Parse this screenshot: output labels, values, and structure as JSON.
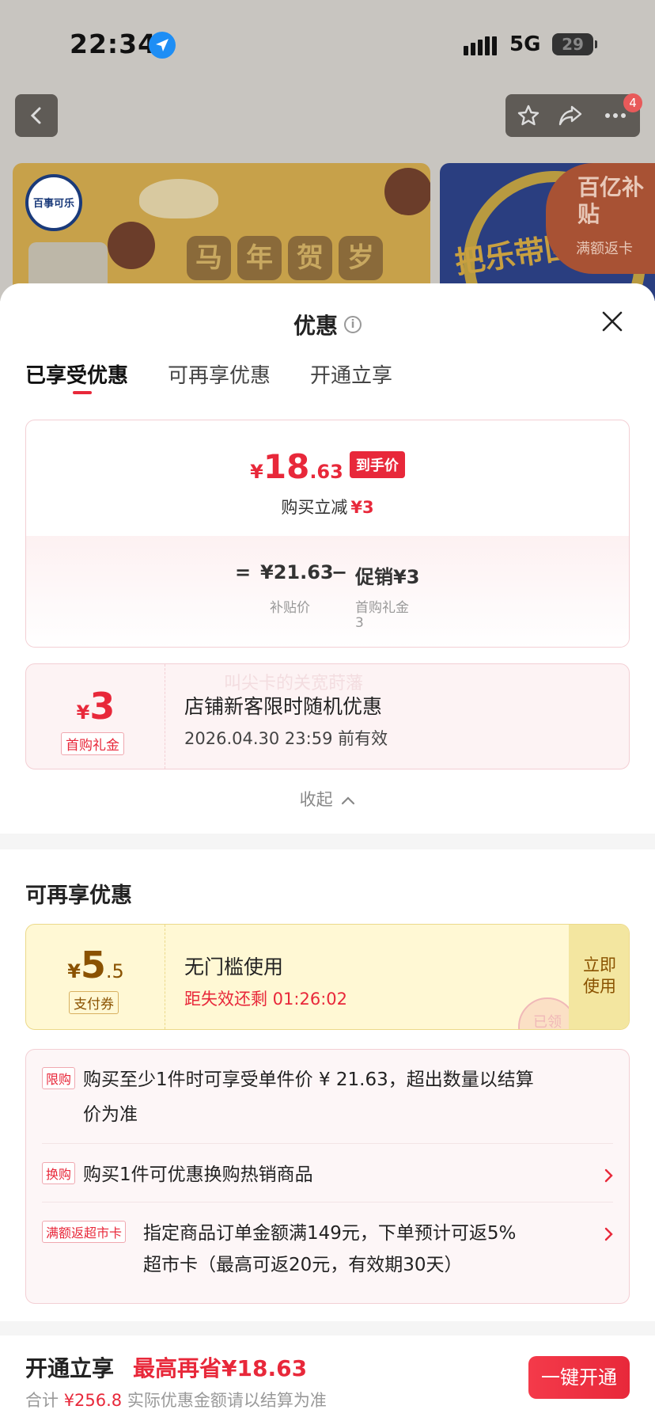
{
  "status_bar": {
    "time": "22:34",
    "network": "5G",
    "battery": "29",
    "icons": [
      "location-arrow-icon",
      "signal-bars-icon",
      "battery-icon"
    ]
  },
  "nav": {
    "badge_count": "4",
    "icons": [
      "chevron-left-icon",
      "star-icon",
      "share-icon",
      "more-icon"
    ]
  },
  "banners": {
    "brand_logo_text": "百事可乐",
    "banner1_title": [
      "马",
      "年",
      "贺",
      "岁"
    ],
    "banner2_text": "把乐带回家",
    "subsidy_title": "百亿补贴",
    "subsidy_sub": "满额返卡"
  },
  "sheet": {
    "title": "优惠",
    "tabs": [
      {
        "label": "已享受优惠",
        "active": true
      },
      {
        "label": "可再享优惠",
        "active": false
      },
      {
        "label": "开通立享",
        "active": false
      }
    ]
  },
  "summary": {
    "currency": "¥",
    "final_price_int": "18",
    "final_price_dec": ".63",
    "final_price_tag": "到手价",
    "reduce_label": "购买立减",
    "reduce_value": "¥3",
    "formula_eq": "=",
    "subsidy_price": "¥21.63",
    "formula_minus": "−",
    "promo_label": "促销¥3",
    "subsidy_price_label": "补贴价",
    "promo_sub_label": "首购礼金",
    "promo_sub_value": "3"
  },
  "coupon_enjoyed": {
    "currency": "¥",
    "amount": "3",
    "tag": "首购礼金",
    "title": "店铺新客限时随机优惠",
    "valid_until": "2026.04.30 23:59 前有效",
    "ghost_text": "叫尖卡的关宽莳藩"
  },
  "collapse_label": "收起",
  "more_offers": {
    "title": "可再享优惠",
    "coupon": {
      "currency": "¥",
      "amount": "5",
      "decimal": ".5",
      "tag": "支付券",
      "title": "无门槛使用",
      "countdown": "距失效还剩 01:26:02",
      "use_label_line1": "立即",
      "use_label_line2": "使用",
      "stamp_text": "已领"
    },
    "perks": [
      {
        "tag": "限购",
        "text_line1": "购买至少1件时可享受单件价 ¥ 21.63，超出数量以结算",
        "text_line2": "价为准",
        "has_arrow": false
      },
      {
        "tag": "换购",
        "text_line1": "购买1件可优惠换购热销商品",
        "text_line2": "",
        "has_arrow": true
      },
      {
        "tag": "满额返超市卡",
        "text_line1": "指定商品订单金额满149元，下单预计可返5%",
        "text_line2": "超市卡（最高可返20元，有效期30天）",
        "has_arrow": true
      }
    ]
  },
  "footer": {
    "title": "开通立享",
    "max_save": "最高再省¥18.63",
    "total_label": "合计",
    "total_amount": "¥256.8",
    "total_note": "实际优惠金额请以结算为准",
    "button_label": "一键开通"
  },
  "colors": {
    "accent_red": "#e8283a",
    "coupon_gold": "#8a5200",
    "coupon_yellow_bg": "#fff8d4",
    "pink_border": "#f3cfd4"
  }
}
